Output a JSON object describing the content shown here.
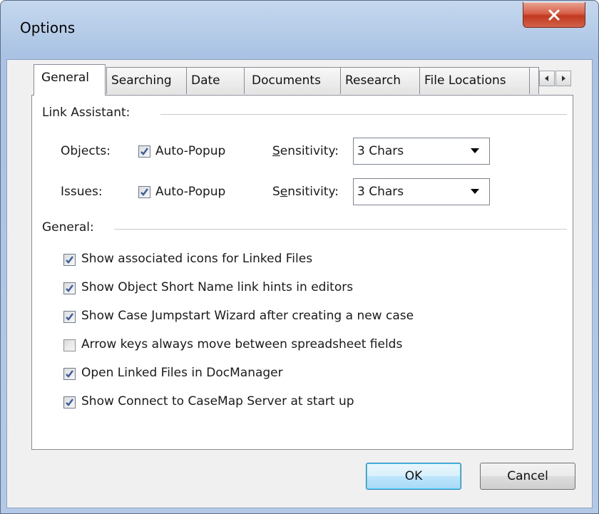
{
  "window": {
    "title": "Options"
  },
  "tabs": [
    {
      "label": "General",
      "active": true
    },
    {
      "label": "Searching"
    },
    {
      "label": "Date"
    },
    {
      "label": "Documents"
    },
    {
      "label": "Research"
    },
    {
      "label": "File Locations"
    }
  ],
  "link_assistant": {
    "label": "Link Assistant:",
    "objects": {
      "label": "Objects:",
      "autopopup_label": "Auto-Popup",
      "autopopup_checked": true,
      "sensitivity_prefix": "S",
      "sensitivity_rest": "ensitivity:",
      "sensitivity_value": "3 Chars"
    },
    "issues": {
      "label": "Issues:",
      "autopopup_label": "Auto-Popup",
      "autopopup_checked": true,
      "sensitivity_prefix": "S",
      "sensitivity_mnemonic": "e",
      "sensitivity_rest": "nsitivity:",
      "sensitivity_value": "3 Chars"
    }
  },
  "general": {
    "label": "General:",
    "options": [
      {
        "label": "Show associated icons for Linked Files",
        "checked": true
      },
      {
        "label": "Show Object Short Name link hints in editors",
        "checked": true
      },
      {
        "label": "Show Case Jumpstart Wizard after creating a new case",
        "checked": true
      },
      {
        "label": "Arrow keys always move between spreadsheet fields",
        "checked": false
      },
      {
        "label": "Open Linked Files in DocManager",
        "checked": true
      },
      {
        "label": "Show Connect to CaseMap Server at start up",
        "checked": true
      }
    ]
  },
  "buttons": {
    "ok": "OK",
    "cancel": "Cancel"
  },
  "colors": {
    "accent": "#3c7fb1",
    "close": "#c2391f"
  }
}
